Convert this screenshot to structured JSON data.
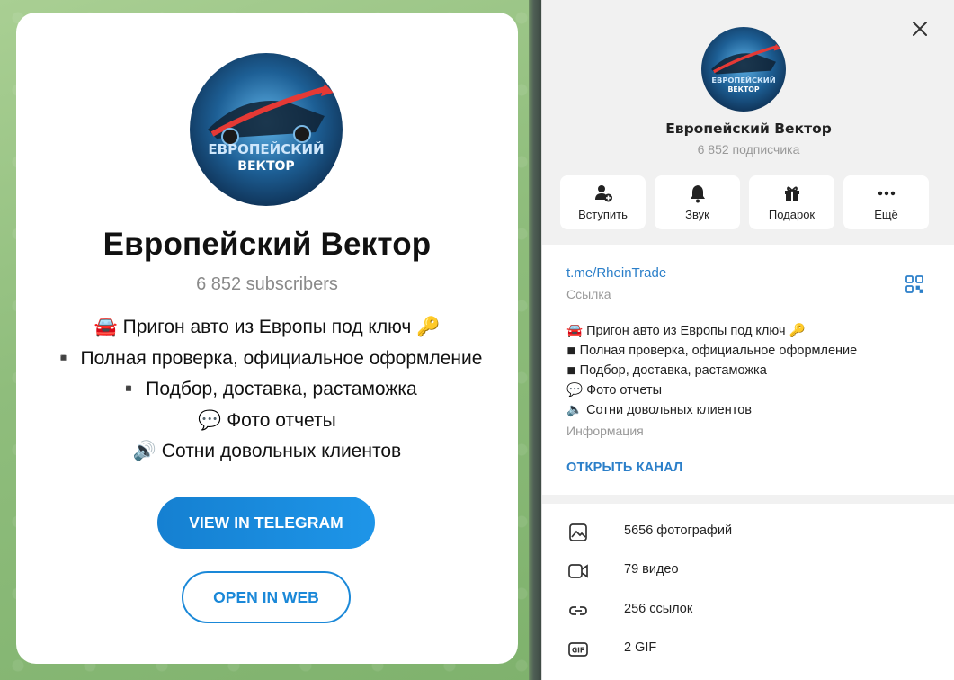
{
  "card": {
    "title": "Европейский Вектор",
    "subscribers": "6 852 subscribers",
    "description": [
      "🚘 Пригон авто из Европы под ключ 🔑",
      "▪️ Полная проверка, официальное оформление",
      "▪️ Подбор, доставка, растаможка",
      "💬 Фото отчеты",
      "🔊 Сотни довольных клиентов"
    ],
    "view_button": "VIEW IN TELEGRAM",
    "web_button": "OPEN IN WEB",
    "logo_text_line1": "ЕВРОПЕЙСКИЙ",
    "logo_text_line2": "ВЕКТОР"
  },
  "panel": {
    "title": "Европейский Вектор",
    "subscribers": "6 852 подписчика",
    "actions": [
      {
        "label": "Вступить",
        "icon": "join-icon"
      },
      {
        "label": "Звук",
        "icon": "bell-icon"
      },
      {
        "label": "Подарок",
        "icon": "gift-icon"
      },
      {
        "label": "Ещё",
        "icon": "more-icon"
      }
    ],
    "link": "t.me/RheinTrade",
    "link_caption": "Ссылка",
    "description": [
      "🚘 Пригон авто из Европы под ключ 🔑",
      "◾ Полная проверка, официальное оформление",
      "◾ Подбор, доставка, растаможка",
      "💬 Фото отчеты",
      "🔈 Сотни довольных клиентов"
    ],
    "description_caption": "Информация",
    "open_channel": "ОТКРЫТЬ КАНАЛ",
    "media": [
      {
        "label": "5656 фотографий",
        "icon": "photo-icon"
      },
      {
        "label": "79 видео",
        "icon": "video-icon"
      },
      {
        "label": "256 ссылок",
        "icon": "link-icon"
      },
      {
        "label": "2 GIF",
        "icon": "gif-icon"
      }
    ]
  },
  "colors": {
    "accent": "#2b7fc9",
    "button": "#1a88d8",
    "background_green": "#8fbd7c"
  }
}
